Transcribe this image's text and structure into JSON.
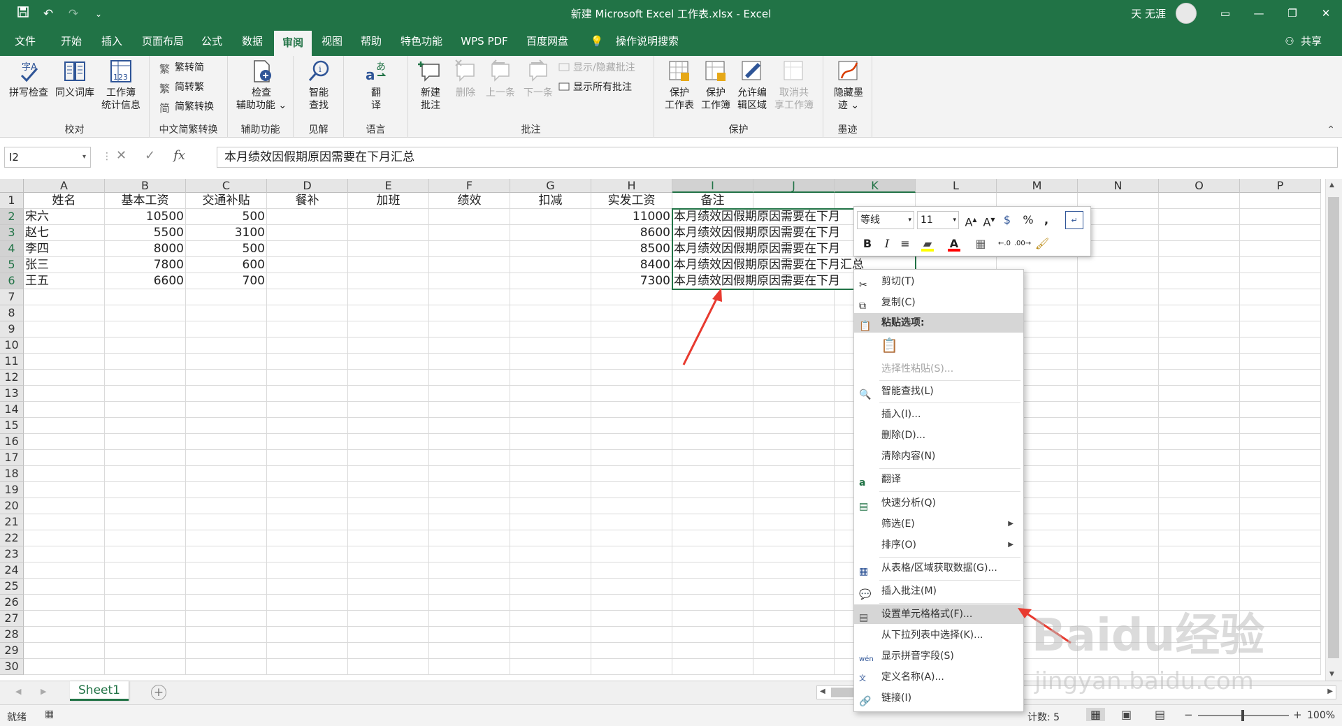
{
  "titlebar": {
    "title": "新建 Microsoft Excel 工作表.xlsx - Excel",
    "user": "天 无涯",
    "qat": [
      "save-icon",
      "undo-icon",
      "redo-icon",
      "customize-icon"
    ]
  },
  "tabs": [
    "文件",
    "开始",
    "插入",
    "页面布局",
    "公式",
    "数据",
    "审阅",
    "视图",
    "帮助",
    "特色功能",
    "WPS PDF",
    "百度网盘",
    "操作说明搜索"
  ],
  "share_label": "共享",
  "ribbon": {
    "proofing": {
      "label": "校对",
      "spell": "拼写检查",
      "thesaurus": "同义词库",
      "stats1": "工作簿",
      "stats2": "统计信息"
    },
    "chinese": {
      "label": "中文简繁转换",
      "t2s": "繁转简",
      "s2t": "简转繁",
      "convert": "简繁转换"
    },
    "accessibility": {
      "label": "辅助功能",
      "b1": "检查",
      "b2": "辅助功能 ⌄"
    },
    "insights": {
      "label": "见解",
      "b1": "智能",
      "b2": "查找"
    },
    "language": {
      "label": "语言",
      "b1": "翻",
      "b2": "译"
    },
    "comments": {
      "label": "批注",
      "new1": "新建",
      "new2": "批注",
      "delete": "删除",
      "prev": "上一条",
      "next": "下一条",
      "toggle": "显示/隐藏批注",
      "showall": "显示所有批注"
    },
    "protect": {
      "label": "保护",
      "sheet1": "保护",
      "sheet2": "工作表",
      "wb1": "保护",
      "wb2": "工作簿",
      "range1": "允许编",
      "range2": "辑区域",
      "unshare1": "取消共",
      "unshare2": "享工作簿"
    },
    "ink": {
      "label": "墨迹",
      "b1": "隐藏墨",
      "b2": "迹 ⌄"
    }
  },
  "formula_bar": {
    "name_box": "I2",
    "formula": "本月绩效因假期原因需要在下月汇总"
  },
  "columns": [
    "A",
    "B",
    "C",
    "D",
    "E",
    "F",
    "G",
    "H",
    "I",
    "J",
    "K",
    "L",
    "M",
    "N",
    "O",
    "P"
  ],
  "rows": [
    "1",
    "2",
    "3",
    "4",
    "5",
    "6",
    "7",
    "8",
    "9",
    "10",
    "11",
    "12",
    "13",
    "14",
    "15",
    "16",
    "17",
    "18",
    "19",
    "20",
    "21",
    "22",
    "23",
    "24",
    "25",
    "26",
    "27",
    "28",
    "29",
    "30"
  ],
  "sheet": {
    "headers": [
      "姓名",
      "基本工资",
      "交通补贴",
      "餐补",
      "加班",
      "绩效",
      "扣减",
      "实发工资",
      "备注"
    ],
    "records": [
      {
        "name": "宋六",
        "base": "10500",
        "transport": "500",
        "pay": "11000",
        "note": "本月绩效因假期原因需要在下月"
      },
      {
        "name": "赵七",
        "base": "5500",
        "transport": "3100",
        "pay": "8600",
        "note": "本月绩效因假期原因需要在下月"
      },
      {
        "name": "李四",
        "base": "8000",
        "transport": "500",
        "pay": "8500",
        "note": "本月绩效因假期原因需要在下月"
      },
      {
        "name": "张三",
        "base": "7800",
        "transport": "600",
        "pay": "8400",
        "note": "本月绩效因假期原因需要在下月汇总"
      },
      {
        "name": "王五",
        "base": "6600",
        "transport": "700",
        "pay": "7300",
        "note": "本月绩效因假期原因需要在下月"
      }
    ]
  },
  "float_toolbar": {
    "font": "等线",
    "size": "11",
    "percent": "%",
    "comma": ","
  },
  "context_menu": {
    "cut": "剪切(T)",
    "copy": "复制(C)",
    "paste_options": "粘贴选项:",
    "paste_special": "选择性粘贴(S)...",
    "smart_lookup": "智能查找(L)",
    "insert": "插入(I)...",
    "delete": "删除(D)...",
    "clear": "清除内容(N)",
    "translate": "翻译",
    "quick_analysis": "快速分析(Q)",
    "filter": "筛选(E)",
    "sort": "排序(O)",
    "get_data": "从表格/区域获取数据(G)...",
    "insert_comment": "插入批注(M)",
    "format_cells": "设置单元格格式(F)...",
    "pick_list": "从下拉列表中选择(K)...",
    "phonetic": "显示拼音字段(S)",
    "define_name": "定义名称(A)...",
    "link": "链接(I)"
  },
  "sheet_tab": "Sheet1",
  "status": {
    "ready": "就绪",
    "count": "计数: 5",
    "zoom": "100%"
  },
  "watermark": {
    "brand": "Baidu经验",
    "url": "jingyan.baidu.com"
  },
  "colors": {
    "excel_green": "#217346",
    "arrow_red": "#e83a2f",
    "selection_fill": "#e2e2e2"
  }
}
